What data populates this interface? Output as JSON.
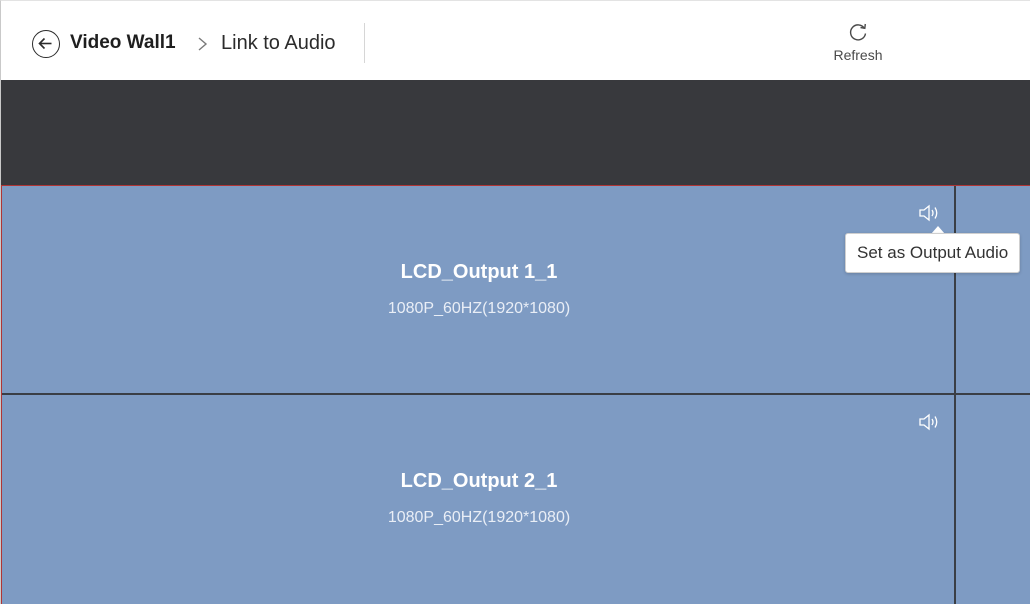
{
  "header": {
    "root_crumb": "Video Wall1",
    "current_crumb": "Link to Audio",
    "refresh_label": "Refresh"
  },
  "screens": [
    {
      "name": "LCD_Output 1_1",
      "resolution": "1080P_60HZ(1920*1080)"
    },
    {
      "name": "LCD_Output 2_1",
      "resolution": "1080P_60HZ(1920*1080)"
    }
  ],
  "tooltip": {
    "text": "Set as Output Audio"
  },
  "colors": {
    "screen_fill": "#7e9bc3",
    "dark_band": "#38393d",
    "wall_border": "#b03535"
  },
  "icons": {
    "back": "back-arrow-circle-icon",
    "breadcrumb_separator": "chevron-right-icon",
    "refresh": "refresh-icon",
    "speaker": "speaker-icon"
  }
}
